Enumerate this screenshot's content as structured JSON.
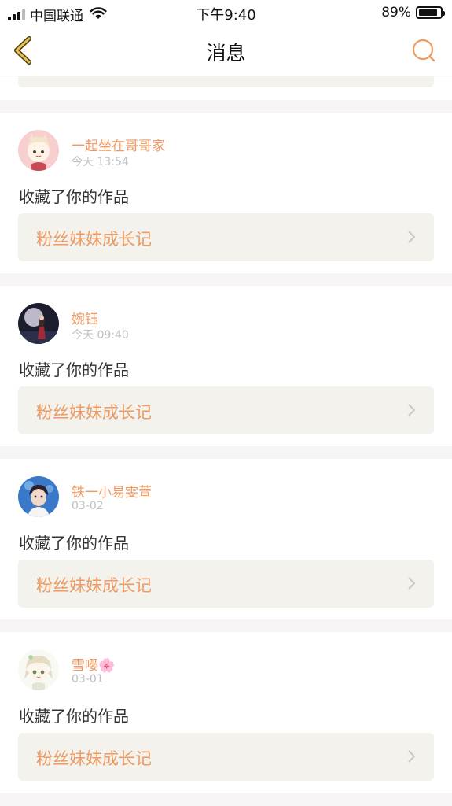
{
  "status": {
    "carrier": "中国联通",
    "time": "下午9:40",
    "battery": "89%",
    "battery_level": 0.89
  },
  "nav": {
    "title": "消息",
    "back_icon": "chevron-left-icon",
    "search_icon": "search-icon"
  },
  "messages": [
    {
      "user": "一起坐在哥哥家",
      "time": "今天 13:54",
      "action": "收藏了你的作品",
      "work": "粉丝妹妹成长记"
    },
    {
      "user": "婉钰",
      "time": "今天 09:40",
      "action": "收藏了你的作品",
      "work": "粉丝妹妹成长记"
    },
    {
      "user": "铁一小易雯萱",
      "time": "03-02",
      "action": "收藏了你的作品",
      "work": "粉丝妹妹成长记"
    },
    {
      "user": "雪嘤🌸",
      "time": "03-01",
      "action": "收藏了你的作品",
      "work": "粉丝妹妹成长记"
    }
  ],
  "colors": {
    "accent": "#ef9a62",
    "nav_icon": "#d9a93a",
    "box_bg": "#f3f2ec",
    "page_bg": "#f6f4f4"
  }
}
